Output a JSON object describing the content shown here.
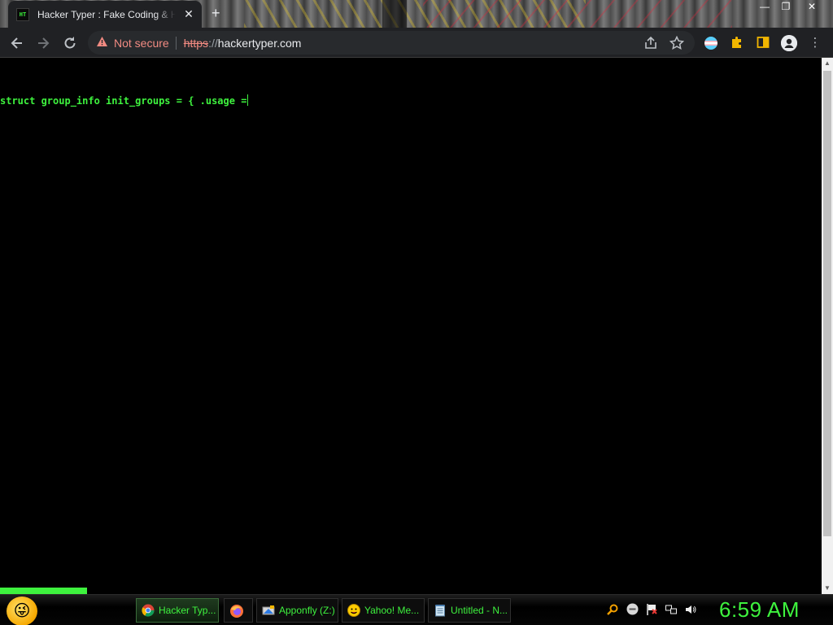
{
  "window": {
    "tab_title": "Hacker Typer : Fake Coding & Hacker Simulator",
    "favicon_text": "HT",
    "new_tab_symbol": "+",
    "close_tab_symbol": "✕",
    "minimize_symbol": "—",
    "restore_symbol": "❐",
    "close_window_symbol": "✕"
  },
  "toolbar": {
    "security_label": "Not secure",
    "url_scheme": "https",
    "url_separator": "://",
    "url_host": "hackertyper.com",
    "icons": [
      "back-icon",
      "forward-icon",
      "reload-icon",
      "warning-icon",
      "share-icon",
      "star-icon",
      "extension-flag-icon",
      "puzzle-icon",
      "sidepanel-icon",
      "profile-icon",
      "menu-icon"
    ]
  },
  "page": {
    "code_text": "struct group_info init_groups = { .usage ="
  },
  "colors": {
    "terminal_green": "#3ef23e",
    "page_background": "#000000",
    "warning_red": "#f28b82"
  },
  "taskbar": {
    "items": [
      {
        "label": "Hacker Typ...",
        "icon": "chrome-icon"
      },
      {
        "label": "",
        "icon": "firefox-icon"
      },
      {
        "label": "Apponfly (Z:)",
        "icon": "drive-icon"
      },
      {
        "label": "Yahoo! Me...",
        "icon": "yahoo-messenger-icon"
      },
      {
        "label": "Untitled - N...",
        "icon": "notepad-icon"
      }
    ],
    "clock": "6:59 AM"
  }
}
